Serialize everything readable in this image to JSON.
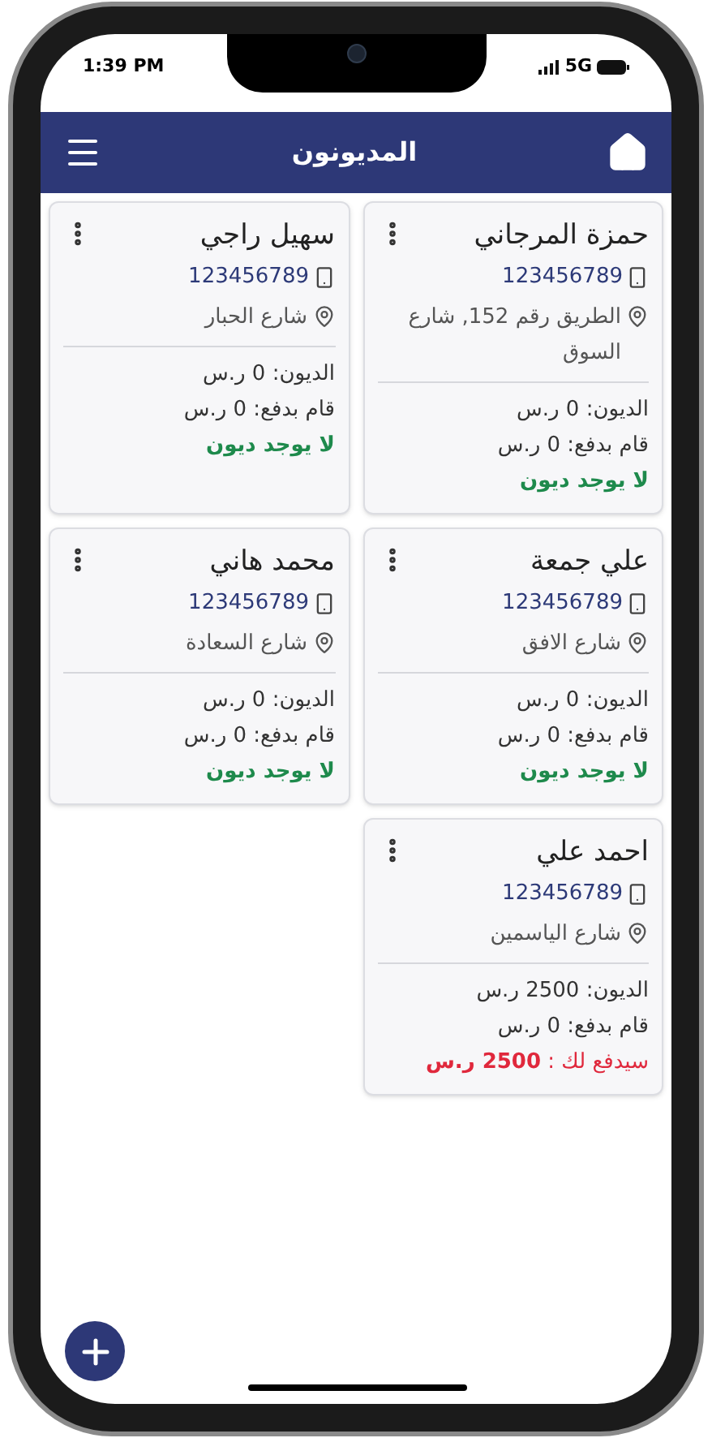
{
  "status_bar": {
    "time": "1:39 PM",
    "network": "5G"
  },
  "header": {
    "title": "المديونون"
  },
  "customers": [
    {
      "name": "حمزة المرجاني",
      "phone": "123456789",
      "address": "الطريق رقم 152, شارع السوق",
      "debt": "الديون: 0 ر.س",
      "paid": "قام بدفع: 0 ر.س",
      "status": {
        "kind": "settled",
        "text": "لا يوجد ديون"
      }
    },
    {
      "name": "سهيل راجي",
      "phone": "123456789",
      "address": "شارع الحبار",
      "debt": "الديون: 0 ر.س",
      "paid": "قام بدفع: 0 ر.س",
      "status": {
        "kind": "settled",
        "text": "لا يوجد ديون"
      }
    },
    {
      "name": "علي جمعة",
      "phone": "123456789",
      "address": "شارع الافق",
      "debt": "الديون: 0 ر.س",
      "paid": "قام بدفع: 0 ر.س",
      "status": {
        "kind": "settled",
        "text": "لا يوجد ديون"
      }
    },
    {
      "name": "محمد هاني",
      "phone": "123456789",
      "address": "شارع السعادة",
      "debt": "الديون: 0 ر.س",
      "paid": "قام بدفع: 0 ر.س",
      "status": {
        "kind": "settled",
        "text": "لا يوجد ديون"
      }
    },
    {
      "name": "احمد علي",
      "phone": "123456789",
      "address": "شارع الياسمين",
      "debt": "الديون: 2500 ر.س",
      "paid": "قام بدفع: 0 ر.س",
      "status": {
        "kind": "owed",
        "text": "سيدفع لك : **2500 ر.س**"
      }
    }
  ]
}
